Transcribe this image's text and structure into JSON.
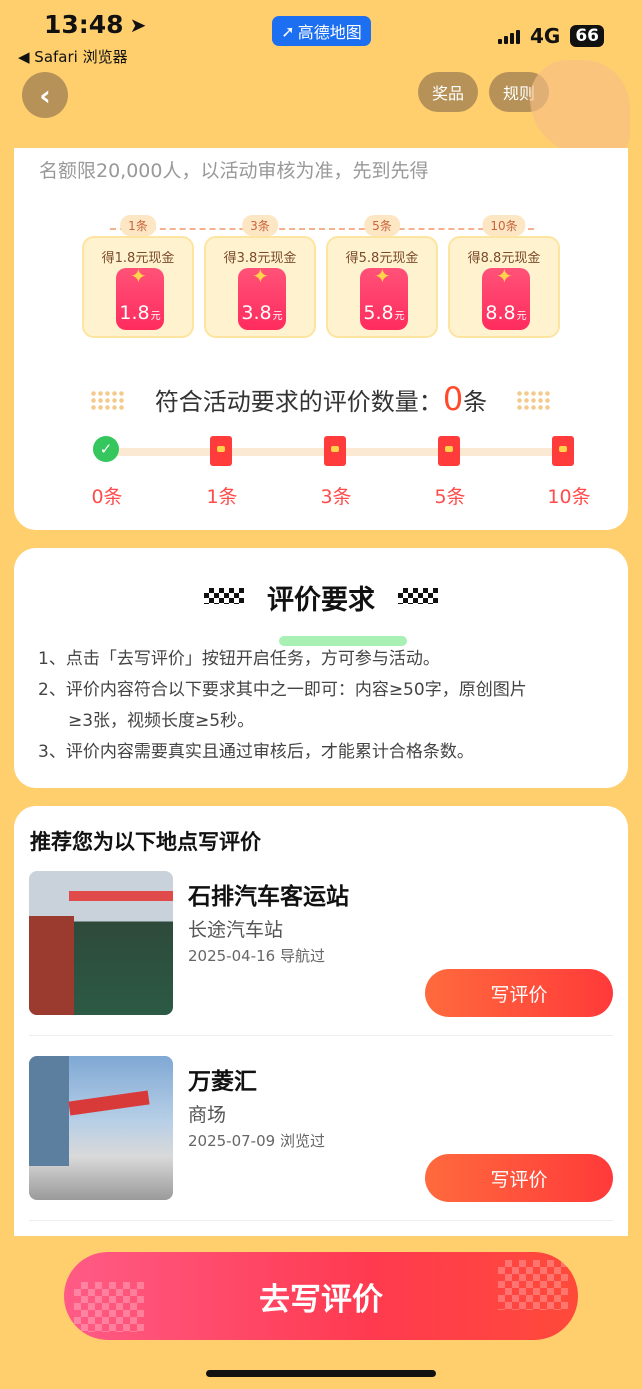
{
  "status_bar": {
    "time": "13:48",
    "back_app": "◀ Safari 浏览器",
    "current_app": "高德地图",
    "network": "4G",
    "battery": "66"
  },
  "nav": {
    "back_icon": "chevron-left-icon",
    "prize_label": "奖品",
    "rules_label": "规则"
  },
  "progress_card": {
    "quota_text": "名额限20,000人，以活动审核为准，先到先得",
    "tiers": [
      {
        "badge": "1条",
        "cash": "得1.8元现金",
        "amount": "1.8",
        "unit": "元"
      },
      {
        "badge": "3条",
        "cash": "得3.8元现金",
        "amount": "3.8",
        "unit": "元"
      },
      {
        "badge": "5条",
        "cash": "得5.8元现金",
        "amount": "5.8",
        "unit": "元"
      },
      {
        "badge": "10条",
        "cash": "得8.8元现金",
        "amount": "8.8",
        "unit": "元"
      }
    ],
    "count_label": "符合活动要求的评价数量：",
    "count_value": "0",
    "count_unit": "条",
    "milestones": [
      "0条",
      "1条",
      "3条",
      "5条",
      "10条"
    ]
  },
  "requirements": {
    "title": "评价要求",
    "items": [
      "1、点击「去写评价」按钮开启任务，方可参与活动。",
      "2、评价内容符合以下要求其中之一即可：内容≥50字，原创图片",
      "≥3张，视频长度≥5秒。",
      "3、评价内容需要真实且通过审核后，才能累计合格条数。"
    ]
  },
  "recommend": {
    "title": "推荐您为以下地点写评价",
    "places": [
      {
        "name": "石排汽车客运站",
        "category": "长途汽车站",
        "date": "2025-04-16 导航过",
        "button": "写评价"
      },
      {
        "name": "万菱汇",
        "category": "商场",
        "date": "2025-07-09 浏览过",
        "button": "写评价"
      }
    ]
  },
  "cta": {
    "label": "去写评价"
  }
}
